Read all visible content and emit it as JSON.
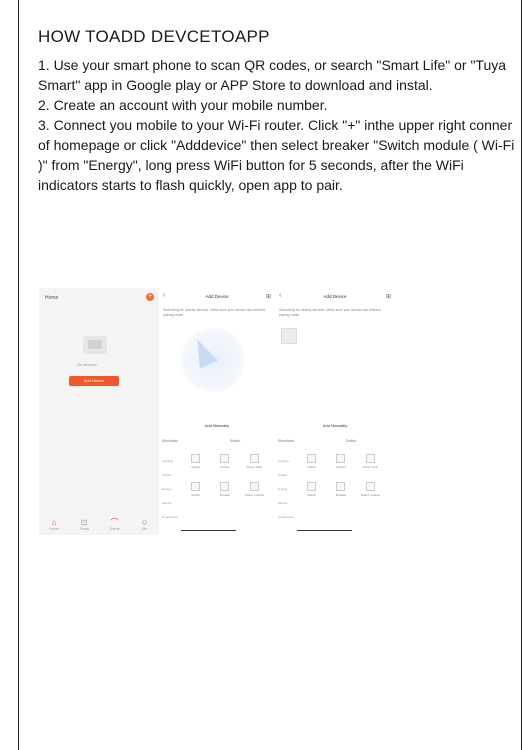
{
  "title": "HOW TOADD DEVCETOAPP",
  "instructions": [
    "1. Use your smart phone to scan QR codes, or search \"Smart Life\" or \"Tuya Smart\" app in Google play or APP Store to download and instal.",
    "2. Create an account with your mobile number.",
    "3. Connect you mobile to your Wi-Fi router. Click \"+\" inthe upper right conner of homepage or click \"Adddevice\" then select breaker \"Switch module ( Wi-Fi )\" from \"Energy\", long press WiFi button for 5 seconds, after the WiFi indicators starts to flash quickly, open app to pair."
  ],
  "colors": {
    "accent": "#f05a2a",
    "border": "#222222"
  },
  "screens": {
    "home": {
      "home_label": "Home",
      "plus_icon": "+",
      "no_devices": "No devices",
      "add_button": "Add Device",
      "nav": [
        "Home",
        "Smart",
        "Scene",
        "Me"
      ]
    },
    "add": {
      "header": "Add Device",
      "scanning": "Searching for nearby devices. Make sure your device has entered pairing mode.",
      "add_manually": "Add Manually",
      "category": "Electrician",
      "sub": "Switch",
      "categories": [
        "Lighting",
        "Socket",
        "Energy",
        "Sensor",
        "Small home"
      ],
      "devices": [
        "Switch",
        "Socket",
        "Power Strip",
        "Switch",
        "Breaker",
        "Switch module"
      ]
    }
  }
}
